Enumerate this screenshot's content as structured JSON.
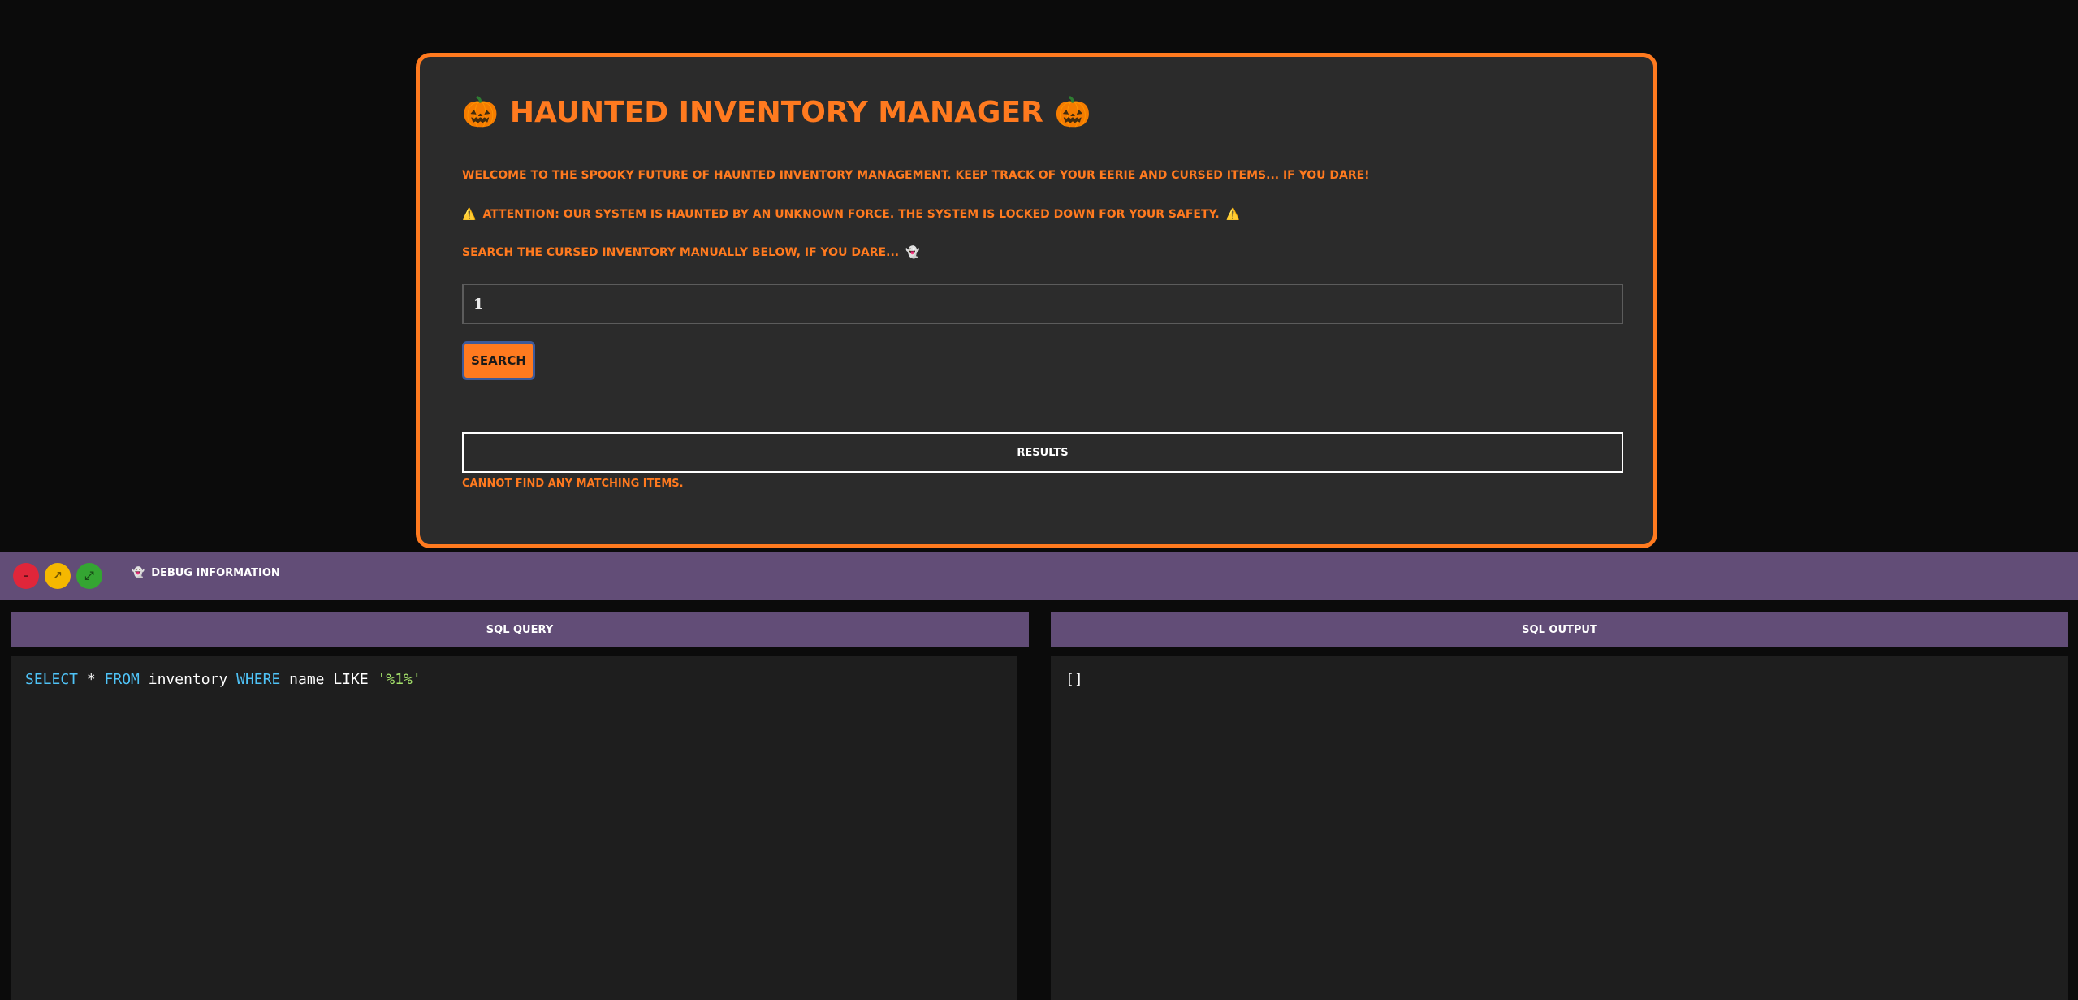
{
  "app": {
    "title_left_icon": "jack-o-lantern-icon",
    "title": "HAUNTED INVENTORY MANAGER",
    "title_right_icon": "jack-o-lantern-icon",
    "welcome_text": "WELCOME TO THE SPOOKY FUTURE OF HAUNTED INVENTORY MANAGEMENT. KEEP TRACK OF YOUR EERIE AND CURSED ITEMS... IF YOU DARE!",
    "attention_text": "ATTENTION: OUR SYSTEM IS HAUNTED BY AN UNKNOWN FORCE. THE SYSTEM IS LOCKED DOWN FOR YOUR SAFETY.",
    "search_prompt": "SEARCH THE CURSED INVENTORY MANUALLY BELOW, IF YOU DARE...",
    "search_value": "1",
    "search_button_label": "SEARCH",
    "results_label": "RESULTS",
    "no_match_text": "CANNOT FIND ANY MATCHING ITEMS.",
    "accent_color": "#ff7a1f"
  },
  "debug": {
    "title": "DEBUG INFORMATION",
    "window_controls": {
      "close_symbol": "–",
      "minimize_symbol": "↗",
      "maximize_symbol": "⤢"
    },
    "sql_query_header": "SQL QUERY",
    "sql_output_header": "SQL OUTPUT",
    "sql_query": {
      "kw_select": "SELECT",
      "star": " * ",
      "kw_from": "FROM",
      "table": " inventory ",
      "kw_where": "WHERE",
      "rest": " name LIKE ",
      "literal": "'%1%'"
    },
    "sql_output": "[]",
    "bar_color": "#624d77"
  },
  "icons": {
    "pumpkin": "🎃",
    "warning": "⚠️",
    "ghost": "👻"
  }
}
